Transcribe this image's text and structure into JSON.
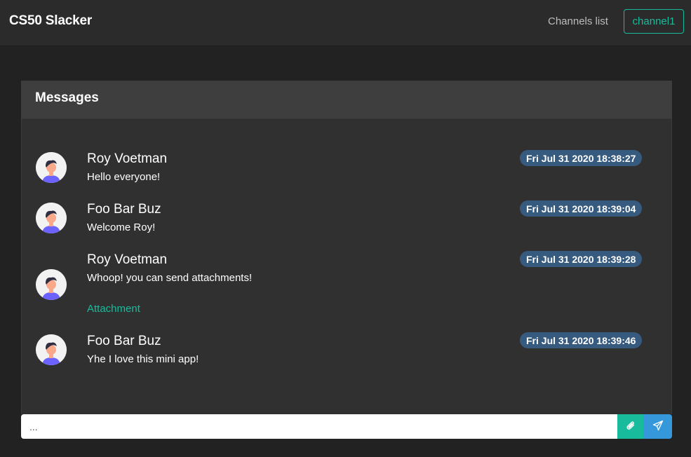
{
  "navbar": {
    "brand": "CS50 Slacker",
    "channels_link": "Channels list",
    "current_channel": "channel1"
  },
  "card": {
    "title": "Messages"
  },
  "messages": [
    {
      "author": "Roy Voetman",
      "text": "Hello everyone!",
      "timestamp": "Fri Jul 31 2020 18:38:27",
      "attachment": ""
    },
    {
      "author": "Foo Bar Buz",
      "text": "Welcome Roy!",
      "timestamp": "Fri Jul 31 2020 18:39:04",
      "attachment": ""
    },
    {
      "author": "Roy Voetman",
      "text": "Whoop! you can send attachments!",
      "timestamp": "Fri Jul 31 2020 18:39:28",
      "attachment": "Attachment"
    },
    {
      "author": "Foo Bar Buz",
      "text": "Yhe I love this mini app!",
      "timestamp": "Fri Jul 31 2020 18:39:46",
      "attachment": ""
    }
  ],
  "composer": {
    "placeholder": "...",
    "attach_icon": "paperclip-icon",
    "send_icon": "paper-plane-icon"
  },
  "colors": {
    "accent_teal": "#18bc9c",
    "send_blue": "#3498db",
    "badge_blue": "#375a7f",
    "background": "#222222",
    "card": "#303030"
  }
}
